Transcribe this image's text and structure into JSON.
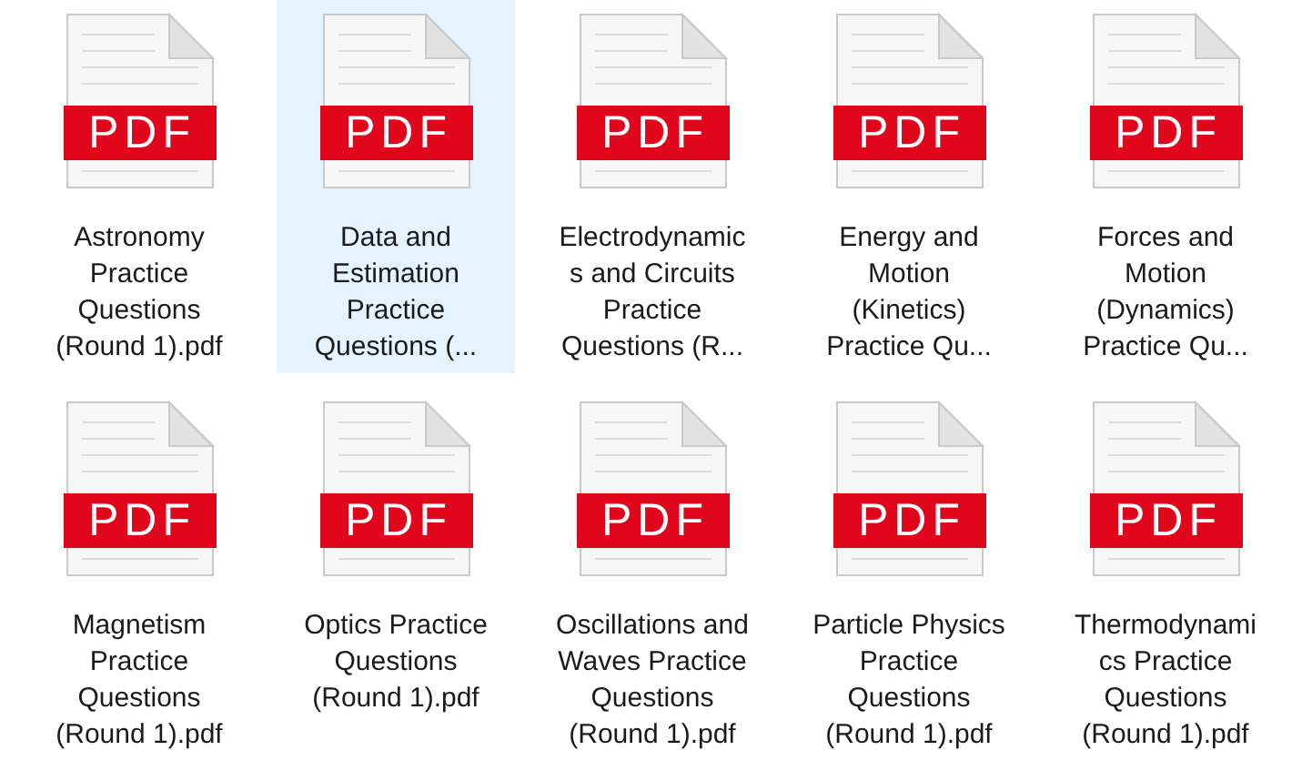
{
  "files": [
    {
      "badge": "PDF",
      "lines": [
        "Astronomy",
        "Practice",
        "Questions",
        "(Round 1).pdf"
      ],
      "selected": false
    },
    {
      "badge": "PDF",
      "lines": [
        "Data and",
        "Estimation",
        "Practice",
        "Questions (..."
      ],
      "selected": true
    },
    {
      "badge": "PDF",
      "lines": [
        "Electrodynamic",
        "s and Circuits",
        "Practice",
        "Questions (R..."
      ],
      "selected": false
    },
    {
      "badge": "PDF",
      "lines": [
        "Energy and",
        "Motion",
        "(Kinetics)",
        "Practice Qu..."
      ],
      "selected": false
    },
    {
      "badge": "PDF",
      "lines": [
        "Forces and",
        "Motion",
        "(Dynamics)",
        "Practice Qu..."
      ],
      "selected": false
    },
    {
      "badge": "PDF",
      "lines": [
        "Magnetism",
        "Practice",
        "Questions",
        "(Round 1).pdf"
      ],
      "selected": false
    },
    {
      "badge": "PDF",
      "lines": [
        "Optics Practice",
        "Questions",
        "(Round 1).pdf"
      ],
      "selected": false
    },
    {
      "badge": "PDF",
      "lines": [
        "Oscillations and",
        "Waves Practice",
        "Questions",
        "(Round 1).pdf"
      ],
      "selected": false
    },
    {
      "badge": "PDF",
      "lines": [
        "Particle Physics",
        "Practice",
        "Questions",
        "(Round 1).pdf"
      ],
      "selected": false
    },
    {
      "badge": "PDF",
      "lines": [
        "Thermodynami",
        "cs Practice",
        "Questions",
        "(Round 1).pdf"
      ],
      "selected": false
    }
  ]
}
